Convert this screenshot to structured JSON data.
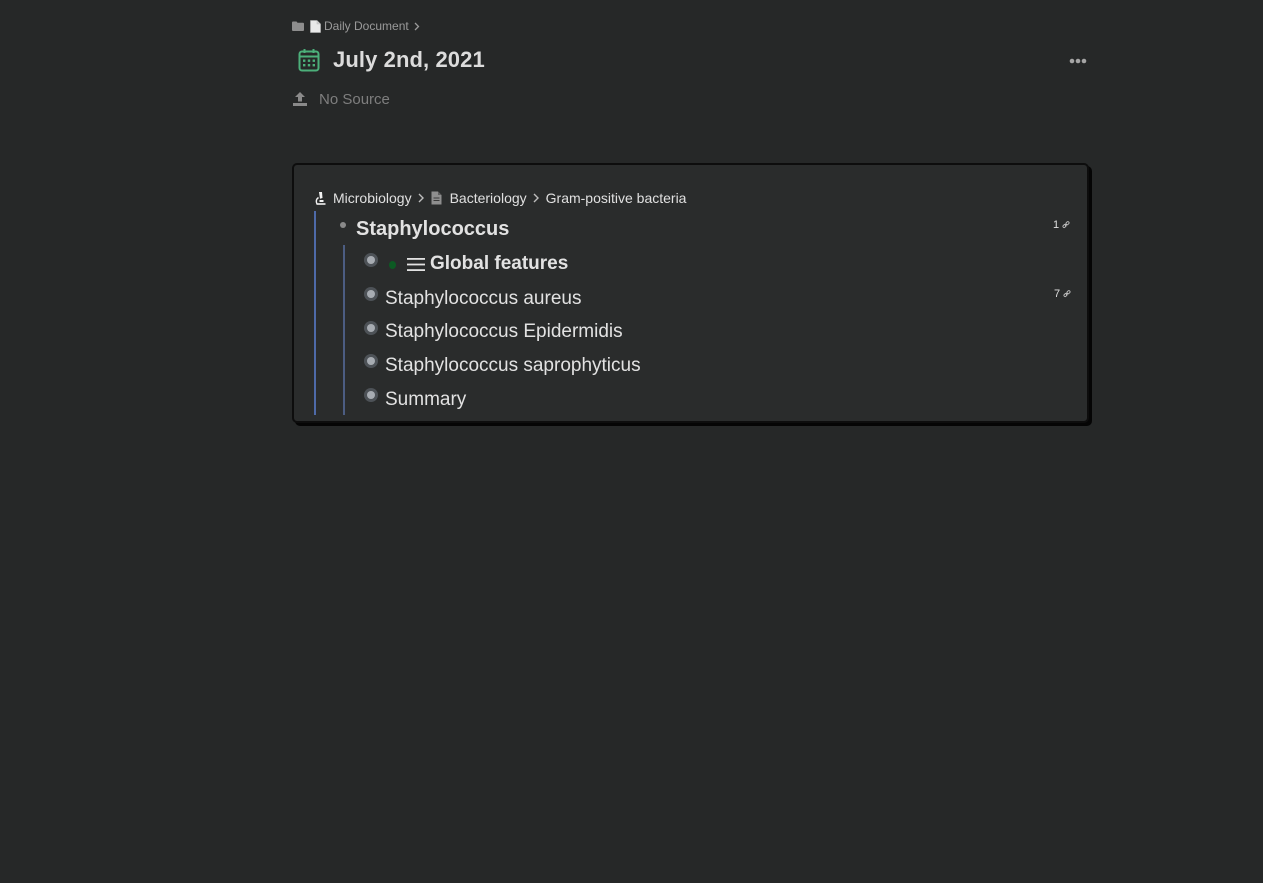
{
  "breadcrumb": {
    "folder_icon": "folder-icon",
    "doc_icon": "document-icon",
    "label": "Daily Document"
  },
  "page": {
    "title": "July 2nd, 2021",
    "title_icon": "calendar-icon",
    "more_icon": "ellipsis-icon",
    "source_icon": "upload-icon",
    "source_label": "No Source"
  },
  "embed": {
    "breadcrumb": {
      "items": [
        {
          "icon": "microscope-icon",
          "label": "Microbiology"
        },
        {
          "icon": "page-icon",
          "label": "Bacteriology"
        },
        {
          "icon": "",
          "label": "Gram-positive bacteria"
        }
      ]
    },
    "root": {
      "label": "Staphylococcus",
      "ref_count": "1"
    },
    "children": [
      {
        "label": "Global features",
        "heading": true,
        "prefix_icon": "list-icon",
        "ref_count": ""
      },
      {
        "label": "Staphylococcus aureus",
        "heading": false,
        "ref_count": "7"
      },
      {
        "label": "Staphylococcus Epidermidis",
        "heading": false,
        "ref_count": ""
      },
      {
        "label": "Staphylococcus saprophyticus",
        "heading": false,
        "ref_count": ""
      },
      {
        "label": "Summary",
        "heading": false,
        "ref_count": ""
      }
    ]
  },
  "colors": {
    "background": "#262828",
    "card": "#2a2c2c",
    "accent_line": "#4e6aa8",
    "calendar": "#4caf7a"
  }
}
